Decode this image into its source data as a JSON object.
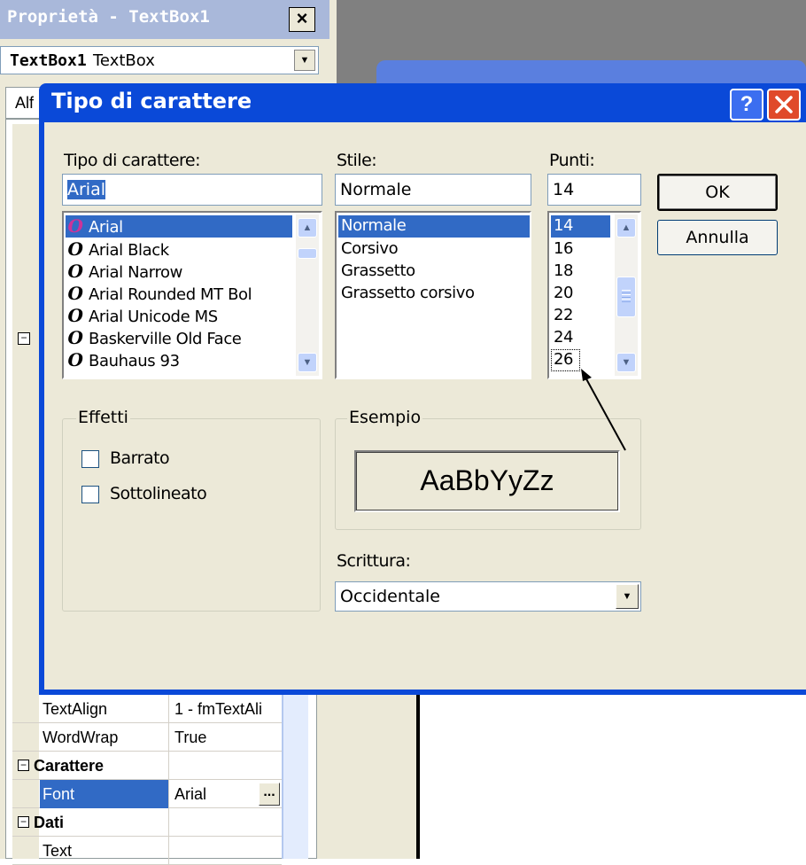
{
  "properties_window": {
    "title": "Proprietà - TextBox1",
    "close_label": "×",
    "object_name": "TextBox1",
    "object_type": "TextBox",
    "tab_label": "Alf",
    "rows": [
      {
        "name": "TextAlign",
        "value": "1 - fmTextAli"
      },
      {
        "name": "WordWrap",
        "value": "True"
      },
      {
        "name": "Carattere",
        "value": ""
      },
      {
        "name": "Font",
        "value": "Arial"
      },
      {
        "name": "Dati",
        "value": ""
      },
      {
        "name": "Text",
        "value": ""
      }
    ]
  },
  "dialog": {
    "title": "Tipo di carattere",
    "help_label": "?",
    "font": {
      "label": "Tipo di carattere:",
      "value": "Arial",
      "items": [
        "Arial",
        "Arial Black",
        "Arial Narrow",
        "Arial Rounded MT Bol",
        "Arial Unicode MS",
        "Baskerville Old Face",
        "Bauhaus 93"
      ],
      "item_icon": "O"
    },
    "style": {
      "label": "Stile:",
      "value": "Normale",
      "items": [
        "Normale",
        "Corsivo",
        "Grassetto",
        "Grassetto corsivo"
      ]
    },
    "size": {
      "label": "Punti:",
      "value": "14",
      "items": [
        "14",
        "16",
        "18",
        "20",
        "22",
        "24",
        "26"
      ]
    },
    "ok_label": "OK",
    "cancel_label": "Annulla",
    "effects": {
      "label": "Effetti",
      "strikeout": "Barrato",
      "underline": "Sottolineato"
    },
    "sample": {
      "label": "Esempio",
      "text": "AaBbYyZz"
    },
    "script": {
      "label": "Scrittura:",
      "value": "Occidentale"
    }
  },
  "colors": {
    "dialog_titlebar": "#0a49d8",
    "selection": "#316ac5",
    "dialog_face": "#ece9d8"
  }
}
